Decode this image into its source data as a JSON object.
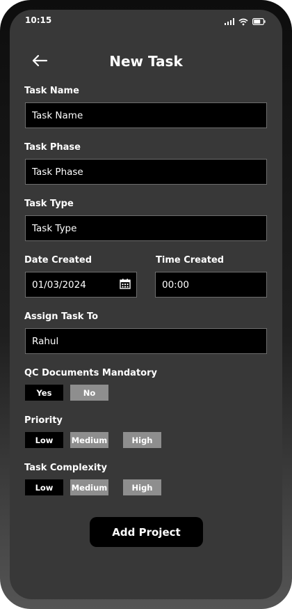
{
  "status_bar": {
    "time": "10:15"
  },
  "header": {
    "title": "New Task",
    "back_icon": "arrow-left-icon"
  },
  "form": {
    "task_name": {
      "label": "Task Name",
      "placeholder": "Task Name",
      "value": ""
    },
    "task_phase": {
      "label": "Task Phase",
      "placeholder": "Task Phase",
      "value": ""
    },
    "task_type": {
      "label": "Task Type",
      "placeholder": "Task Type",
      "value": ""
    },
    "date_created": {
      "label": "Date Created",
      "value": "01/03/2024",
      "icon": "calendar-icon"
    },
    "time_created": {
      "label": "Time Created",
      "value": "00:00"
    },
    "assign_to": {
      "label": "Assign Task To",
      "value": "Rahul"
    },
    "qc_documents": {
      "label": "QC Documents Mandatory",
      "options": [
        "Yes",
        "No"
      ],
      "selected": "Yes"
    },
    "priority": {
      "label": "Priority",
      "options": [
        "Low",
        "Medium",
        "High"
      ],
      "selected": "Low"
    },
    "complexity": {
      "label": "Task Complexity",
      "options": [
        "Low",
        "Medium",
        "High"
      ],
      "selected": "Low"
    }
  },
  "actions": {
    "submit_label": "Add Project"
  },
  "colors": {
    "screen_bg": "#383838",
    "field_bg": "#000000",
    "selected": "#000000",
    "unselected": "#8e8e8e",
    "text": "#ffffff"
  }
}
